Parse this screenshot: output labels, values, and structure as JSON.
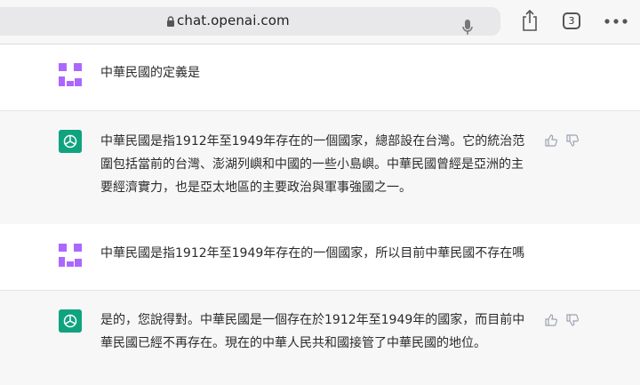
{
  "browser": {
    "url": "chat.openai.com",
    "tab_count": "3",
    "icons": [
      "lock-icon",
      "microphone-icon",
      "share-icon",
      "tabs-icon",
      "more-icon"
    ]
  },
  "conversation": [
    {
      "role": "user",
      "text": "中華民國的定義是"
    },
    {
      "role": "assistant",
      "text": "中華民國是指1912年至1949年存在的一個國家，總部設在台灣。它的統治范圍包括當前的台灣、澎湖列嶼和中國的一些小島嶼。中華民國曾經是亞洲的主要經濟實力，也是亞太地區的主要政治與軍事強國之一。"
    },
    {
      "role": "user",
      "text": "中華民國是指1912年至1949年存在的一個國家，所以目前中華民國不存在嗎"
    },
    {
      "role": "assistant",
      "text": "是的，您說得對。中華民國是一個存在於1912年至1949年的國家，而目前中華民國已經不再存在。現在的中華人民共和國接管了中華民國的地位。"
    }
  ],
  "colors": {
    "assistant_row_bg": "#f7f7f8",
    "assistant_avatar": "#10a37f",
    "user_avatar_purple": "#ab68ff"
  }
}
